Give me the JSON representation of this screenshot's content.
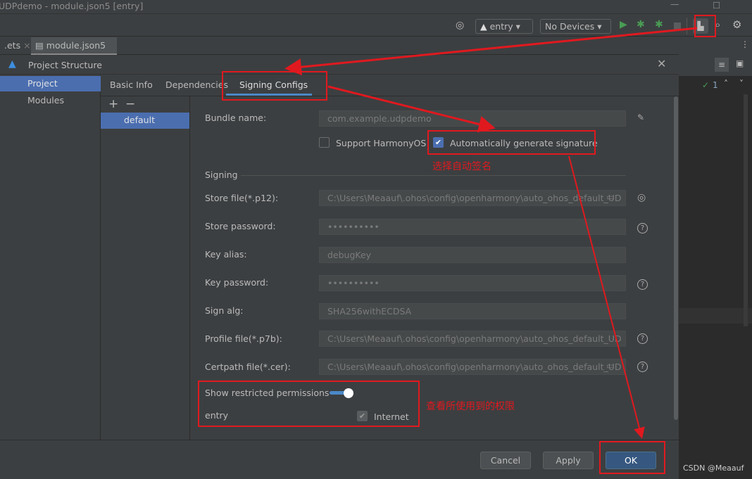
{
  "window": {
    "title": "UDPdemo - module.json5 [entry]"
  },
  "toolbar": {
    "module": "entry",
    "device": "No Devices",
    "icons": [
      "locate-icon",
      "run-icon",
      "debug-icon",
      "attach-debugger-icon",
      "stop-icon",
      "project-structure-icon",
      "search-icon",
      "settings-icon"
    ]
  },
  "editor_tabs": [
    {
      "label": ".ets"
    },
    {
      "label": "module.json5"
    }
  ],
  "dialog": {
    "title": "Project Structure",
    "sidebar": [
      {
        "label": "Project",
        "selected": true
      },
      {
        "label": "Modules"
      }
    ],
    "tabs": [
      {
        "label": "Basic Info"
      },
      {
        "label": "Dependencies"
      },
      {
        "label": "Signing Configs",
        "active": true
      }
    ],
    "configs": [
      {
        "label": "default",
        "selected": true
      }
    ],
    "form": {
      "bundle_name_label": "Bundle name:",
      "bundle_name": "com.example.udpdemo",
      "support_harmonyos": "Support HarmonyOS",
      "support_harmonyos_checked": false,
      "auto_sign": "Automatically generate signature",
      "auto_sign_checked": true,
      "signing_section": "Signing",
      "store_file_label": "Store file(*.p12):",
      "store_file": "C:\\Users\\Meaauf\\.ohos\\config\\openharmony\\auto_ohos_default_UD",
      "store_password_label": "Store password:",
      "store_password": "••••••••••",
      "key_alias_label": "Key alias:",
      "key_alias": "debugKey",
      "key_password_label": "Key password:",
      "key_password": "••••••••••",
      "sign_alg_label": "Sign alg:",
      "sign_alg": "SHA256withECDSA",
      "profile_file_label": "Profile file(*.p7b):",
      "profile_file": "C:\\Users\\Meaauf\\.ohos\\config\\openharmony\\auto_ohos_default_UD",
      "certpath_file_label": "Certpath file(*.cer):",
      "certpath_file": "C:\\Users\\Meaauf\\.ohos\\config\\openharmony\\auto_ohos_default_UD",
      "show_restricted_label": "Show restricted permissions",
      "show_restricted_on": true,
      "module": "entry",
      "permission": "Internet",
      "permission_checked": true
    },
    "buttons": {
      "cancel": "Cancel",
      "apply": "Apply",
      "ok": "OK"
    }
  },
  "editor": {
    "inspection_count": "1"
  },
  "annotations": {
    "auto_sign_note": "选择自动签名",
    "permissions_note": "查看所使用到的权限"
  },
  "watermark": "CSDN @Meaauf",
  "colors": {
    "accent": "#4b6eaf",
    "annotation": "#e0191f",
    "ok_button": "#365880"
  }
}
